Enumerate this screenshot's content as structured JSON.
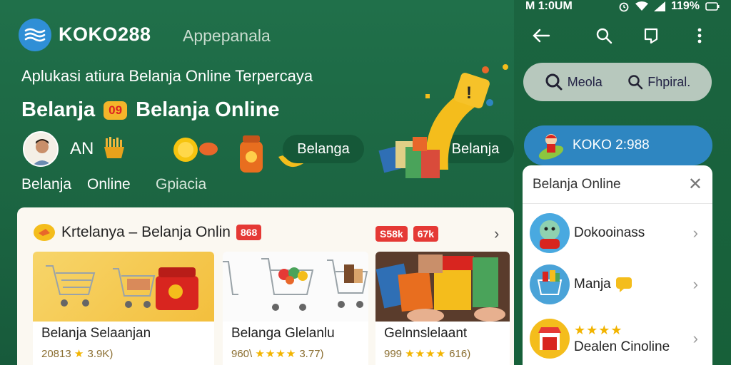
{
  "header": {
    "brand": "KOKO288",
    "app_label": "Appepanala",
    "tagline": "Aplukasi atiura Belanja Online Terpercaya",
    "headline_left": "Belanja",
    "headline_badge": "09",
    "headline_right": "Belanja Online",
    "an_label": "AN",
    "labels": {
      "belanja": "Belanja",
      "online": "Online",
      "gpiacia": "Gpiacia"
    },
    "pills": [
      "Belanga",
      "Belanja"
    ]
  },
  "card": {
    "title": "Krtelanya – Belanja Onlin",
    "title_badge": "868",
    "badges": [
      "S58k",
      "67k"
    ],
    "products": [
      {
        "title": "Belanja Selaanjan",
        "meta_prefix": "20813",
        "stars": "★",
        "meta_suffix": "3.9K)"
      },
      {
        "title": "Belanga Glelanlu",
        "meta_prefix": "960\\",
        "stars": "★★★★",
        "meta_suffix": "3.77)"
      },
      {
        "title": "Gelnnslelaant",
        "meta_prefix": "999",
        "stars": "★★★★",
        "meta_suffix": "616)"
      }
    ]
  },
  "phone": {
    "status_time": "M 1:0UM",
    "status_battery": "119%",
    "chips": [
      "Meola",
      "Fhpiral."
    ],
    "brand_pill": "KOKO 2:988",
    "menu": {
      "title": "Belanja Online",
      "items": [
        {
          "label": "Dokooinass"
        },
        {
          "label": "Manja"
        },
        {
          "label": "Dealen Cinoline",
          "stars": "★★★★"
        }
      ]
    }
  },
  "colors": {
    "bg_green": "#1f6b45",
    "brand_blue": "#2e86c1",
    "accent_yellow": "#f4b52a",
    "badge_red": "#e53935"
  }
}
